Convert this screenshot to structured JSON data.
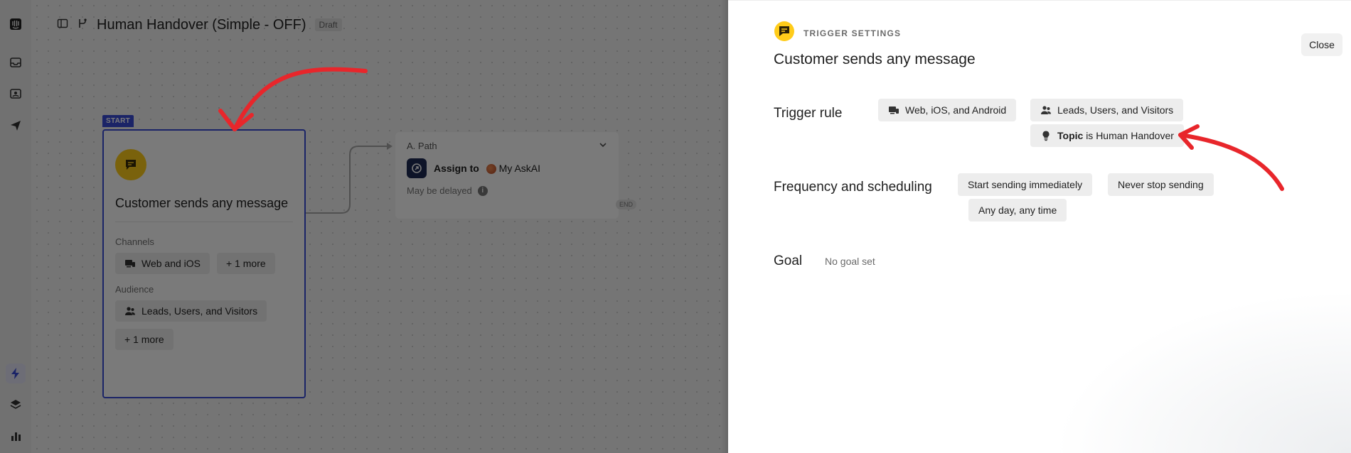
{
  "app": {
    "workflow_title": "Human Handover (Simple - OFF)",
    "status_badge": "Draft",
    "rail_icons": [
      "logo-icon",
      "inbox-icon",
      "knowledge-icon",
      "outbound-icon",
      "workflow-icon",
      "layers-icon",
      "reports-icon"
    ]
  },
  "start_node": {
    "start_label": "START",
    "title": "Customer sends any message",
    "channels_label": "Channels",
    "channels_chip": "Web and iOS",
    "channels_more": "+ 1 more",
    "audience_label": "Audience",
    "audience_chip": "Leads, Users, and Visitors",
    "audience_more": "+ 1 more"
  },
  "path_node": {
    "name": "A. Path",
    "assign_prefix": "Assign to",
    "assignee": "My AskAI",
    "delay_text": "May be delayed",
    "info": "i",
    "end_label": "END"
  },
  "panel": {
    "kicker": "TRIGGER SETTINGS",
    "title": "Customer sends any message",
    "close_label": "Close",
    "trigger_rule": {
      "label": "Trigger rule",
      "channels": "Web, iOS, and Android",
      "audience": "Leads, Users, and Visitors",
      "topic_key": "Topic",
      "topic_op": "is Human Handover"
    },
    "frequency": {
      "label": "Frequency and scheduling",
      "start": "Start sending immediately",
      "stop": "Never stop sending",
      "window": "Any day, any time"
    },
    "goal": {
      "label": "Goal",
      "value": "No goal set"
    }
  },
  "colors": {
    "accent": "#3a4bd8",
    "trigger_yellow": "#ffcc1a",
    "annotation_red": "#e8262b"
  }
}
